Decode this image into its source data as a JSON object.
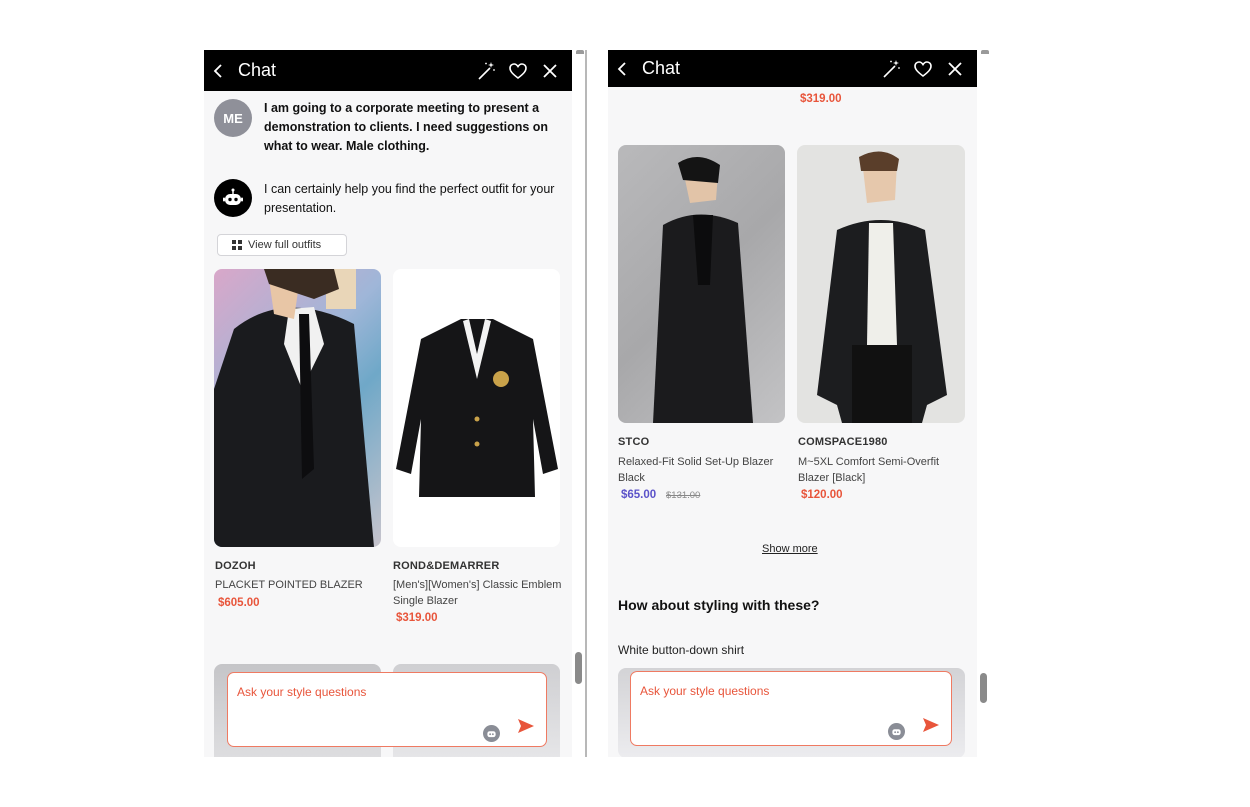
{
  "header": {
    "title": "Chat",
    "back_icon": "chevron-left-icon",
    "actions": [
      "magic-wand-icon",
      "heart-icon",
      "close-icon"
    ]
  },
  "colors": {
    "accent": "#e8553b",
    "sale": "#5b52c9",
    "header_bg": "#000000",
    "panel_bg": "#f7f7f8"
  },
  "left": {
    "user_avatar": "ME",
    "user_message": "I am going to a corporate meeting to present a demonstration to clients. I need suggestions on what to wear. Male clothing.",
    "bot_message": "I can certainly help you find the perfect outfit for your presentation.",
    "view_outfits_label": "View full outfits",
    "products": [
      {
        "brand": "DOZOH",
        "name": "PLACKET POINTED BLAZER",
        "price": "$605.00"
      },
      {
        "brand": "ROND&DEMARRER",
        "name": "[Men's][Women's] Classic Emblem Single Blazer",
        "price": "$319.00"
      }
    ]
  },
  "right": {
    "top_price": "$319.00",
    "products": [
      {
        "brand": "STCO",
        "name": "Relaxed-Fit Solid Set-Up Blazer Black",
        "price": "$65.00",
        "original_price": "$131.00"
      },
      {
        "brand": "COMSPACE1980",
        "name": "M~5XL Comfort Semi-Overfit Blazer [Black]",
        "price": "$120.00"
      }
    ],
    "show_more_label": "Show more",
    "styling_title": "How about styling with these?",
    "styling_item": "White button-down shirt"
  },
  "input": {
    "placeholder": "Ask your style questions",
    "value": ""
  }
}
